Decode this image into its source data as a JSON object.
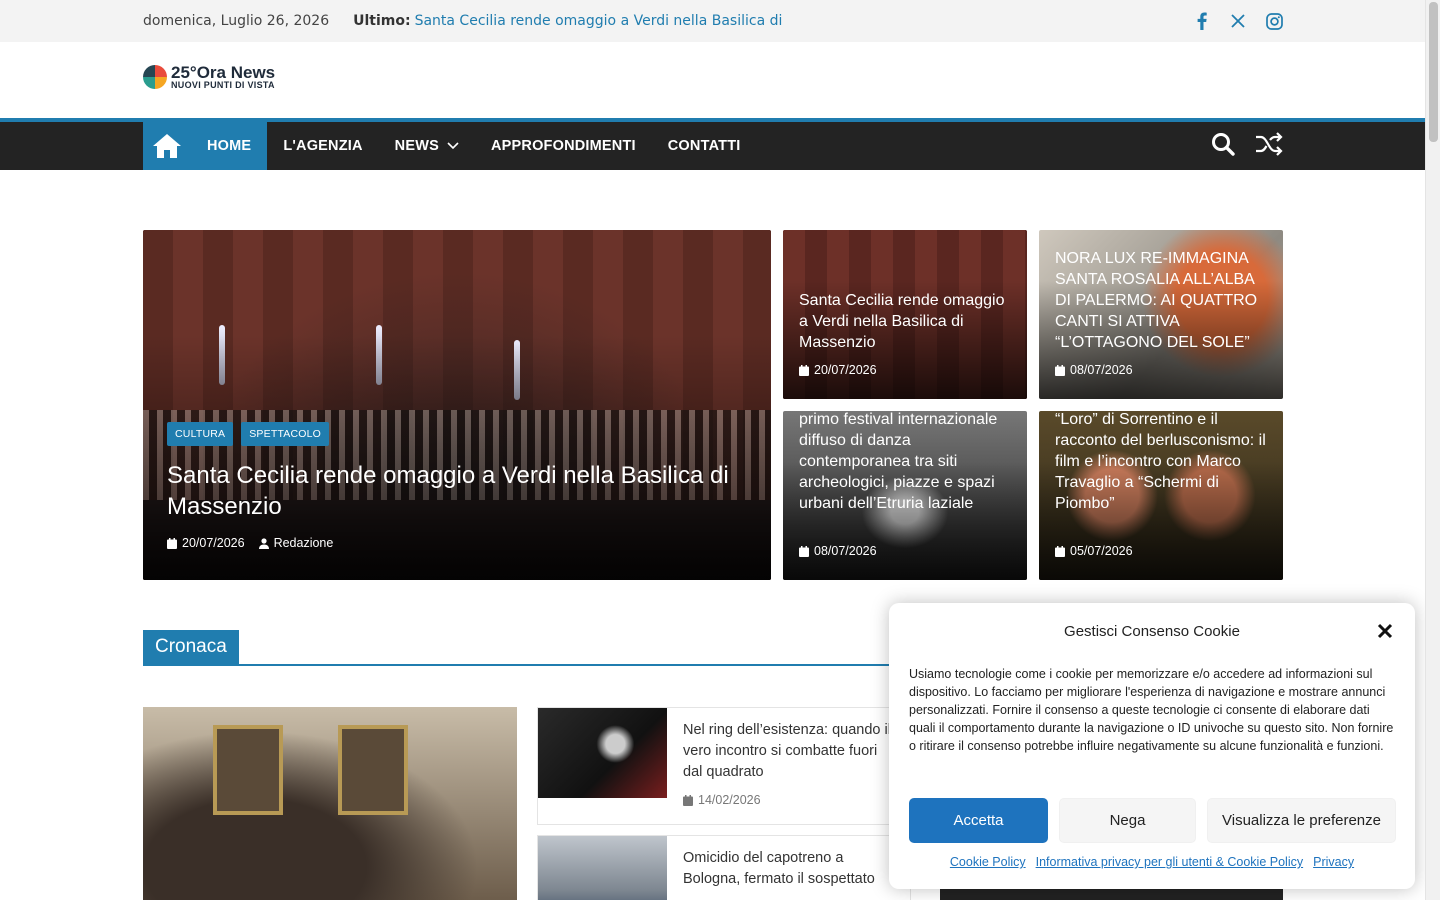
{
  "topbar": {
    "date": "domenica, Luglio 26, 2026",
    "latest_label": "Ultimo:",
    "latest_link": "Santa Cecilia rende omaggio a Verdi nella Basilica di",
    "social": [
      "facebook-icon",
      "x-icon",
      "instagram-icon"
    ]
  },
  "logo": {
    "title": "25°Ora News",
    "subtitle": "NUOVI PUNTI DI VISTA"
  },
  "nav": {
    "items": [
      {
        "label": "HOME",
        "active": true
      },
      {
        "label": "L'AGENZIA"
      },
      {
        "label": "NEWS",
        "has_dropdown": true
      },
      {
        "label": "APPROFONDIMENTI"
      },
      {
        "label": "CONTATTI"
      }
    ],
    "icons": [
      "home-icon",
      "search-icon",
      "shuffle-icon"
    ]
  },
  "featured": {
    "main": {
      "tags": [
        "CULTURA",
        "SPETTACOLO"
      ],
      "title": "Santa Cecilia rende omaggio a Verdi nella Basilica di Massenzio",
      "date": "20/07/2026",
      "author": "Redazione"
    },
    "small": [
      {
        "title": "Santa Cecilia rende omaggio a Verdi nella Basilica di Massenzio",
        "date": "20/07/2026"
      },
      {
        "title": "NORA LUX RE-IMMAGINA SANTA ROSALIA ALL’ALBA DI PALERMO: AI QUATTRO CANTI SI ATTIVA “L’OTTAGONO DEL SOLE”",
        "date": "08/07/2026"
      },
      {
        "title": "primo festival internazionale diffuso di danza contemporanea tra siti archeologici, piazze e spazi urbani dell’Etruria laziale",
        "date": "08/07/2026"
      },
      {
        "title": "“Loro” di Sorrentino e il racconto del berlusconismo: il film e l’incontro con Marco Travaglio a “Schermi di Piombo”",
        "date": "05/07/2026"
      }
    ]
  },
  "section": {
    "title": "Cronaca"
  },
  "cronaca_list": [
    {
      "title": "Nel ring dell’esistenza: quando il vero incontro si combatte fuori dal quadrato",
      "date": "14/02/2026"
    },
    {
      "title": "Omicidio del capotreno a Bologna, fermato il sospettato",
      "date": ""
    }
  ],
  "cookie": {
    "title": "Gestisci Consenso Cookie",
    "body": "Usiamo tecnologie come i cookie per memorizzare e/o accedere ad informazioni sul dispositivo. Lo facciamo per migliorare l'esperienza di navigazione e mostrare annunci personalizzati. Fornire il consenso a queste tecnologie ci consente di elaborare dati quali il comportamento durante la navigazione o ID univoche su questo sito. Non fornire o ritirare il consenso potrebbe influire negativamente su alcune funzionalità e funzioni.",
    "accept": "Accetta",
    "deny": "Nega",
    "preferences": "Visualizza le preferenze",
    "links": [
      "Cookie Policy",
      "Informativa privacy per gli utenti & Cookie Policy",
      "Privacy"
    ]
  },
  "colors": {
    "accent": "#207daf",
    "nav_bg": "#232323",
    "cookie_accept": "#1e73be"
  }
}
